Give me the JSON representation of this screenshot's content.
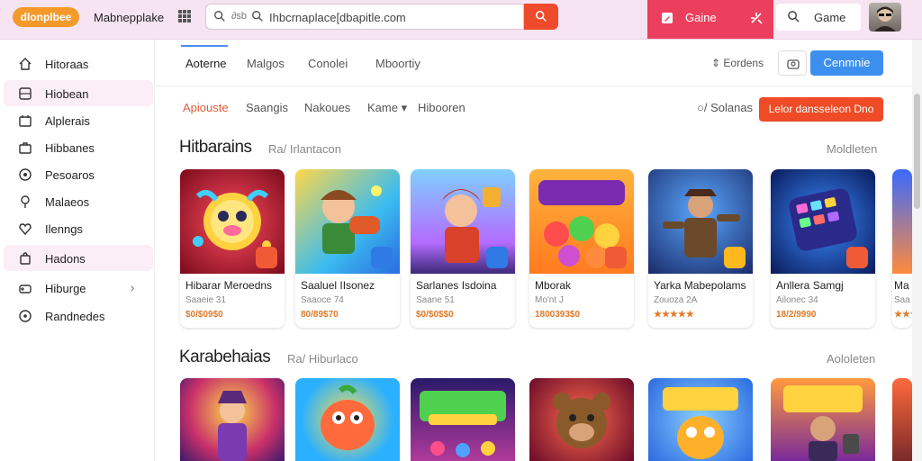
{
  "header": {
    "logo_text": "dlonplbee",
    "brand": "Mabnepplake",
    "search_scope": "∂sb",
    "search_value": "Ihbcrnaplace[dbapitle.com",
    "game_button": "Gaine",
    "game2_label": "Game",
    "accent": "#ef4a2b"
  },
  "sidebar": {
    "items": [
      {
        "label": "Hitoraas",
        "icon": "home-icon"
      },
      {
        "label": "Hiobean",
        "icon": "grid-icon",
        "active": true
      },
      {
        "label": "Alplerais",
        "icon": "apps-icon"
      },
      {
        "label": "Hibbanes",
        "icon": "briefcase-icon"
      },
      {
        "label": "Pesoaros",
        "icon": "circle-icon"
      },
      {
        "label": "Malaeos",
        "icon": "pin-icon"
      },
      {
        "label": "Ilenngs",
        "icon": "heart-icon"
      },
      {
        "label": "Hadons",
        "icon": "bag-icon",
        "active": true
      },
      {
        "label": "Hiburge",
        "icon": "gamepad-icon",
        "chevron": "›"
      },
      {
        "label": "Randnedes",
        "icon": "target-icon"
      }
    ]
  },
  "tabs": [
    "Aoterne",
    "Malgos",
    "Conolei",
    "Mboortiy"
  ],
  "editors_label": "Eordens",
  "continue_label": "Cenmnie",
  "subtabs": [
    "Apiouste",
    "Saangis",
    "Nakoues",
    "Kame ▾",
    "Hibooren"
  ],
  "solanas_label": "○/ Solanas",
  "cta_label": "Lelor dansseleon Dno",
  "sections": [
    {
      "title": "Hitbarains",
      "subtitle": "Ra/ Irlantacon",
      "more": "Moldleten"
    },
    {
      "title": "Karabehaias",
      "subtitle": "Ra/ Hiburlaco",
      "more": "Aololeten"
    }
  ],
  "cards": [
    {
      "name": "Hibarar Meroedns",
      "meta": "Saaeie 31",
      "rating": "$0/$09$0"
    },
    {
      "name": "Saaluel IIsonez",
      "meta": "Saaoce 74",
      "rating": "80/89$70"
    },
    {
      "name": "Sarlanes Isdoina",
      "meta": "Saane 51",
      "rating": "$0/$0$$0"
    },
    {
      "name": "Mborak",
      "meta": "Mo'nt J",
      "rating": "1800393$0"
    },
    {
      "name": "Yarka Mabepolams",
      "meta": "Zouoza 2A",
      "rating": "★★★★★"
    },
    {
      "name": "Anllera Samgj",
      "meta": "Ailonec 34",
      "rating": "18/2/9990"
    },
    {
      "name": "Ma",
      "meta": "Saa",
      "rating": "★★★"
    }
  ]
}
